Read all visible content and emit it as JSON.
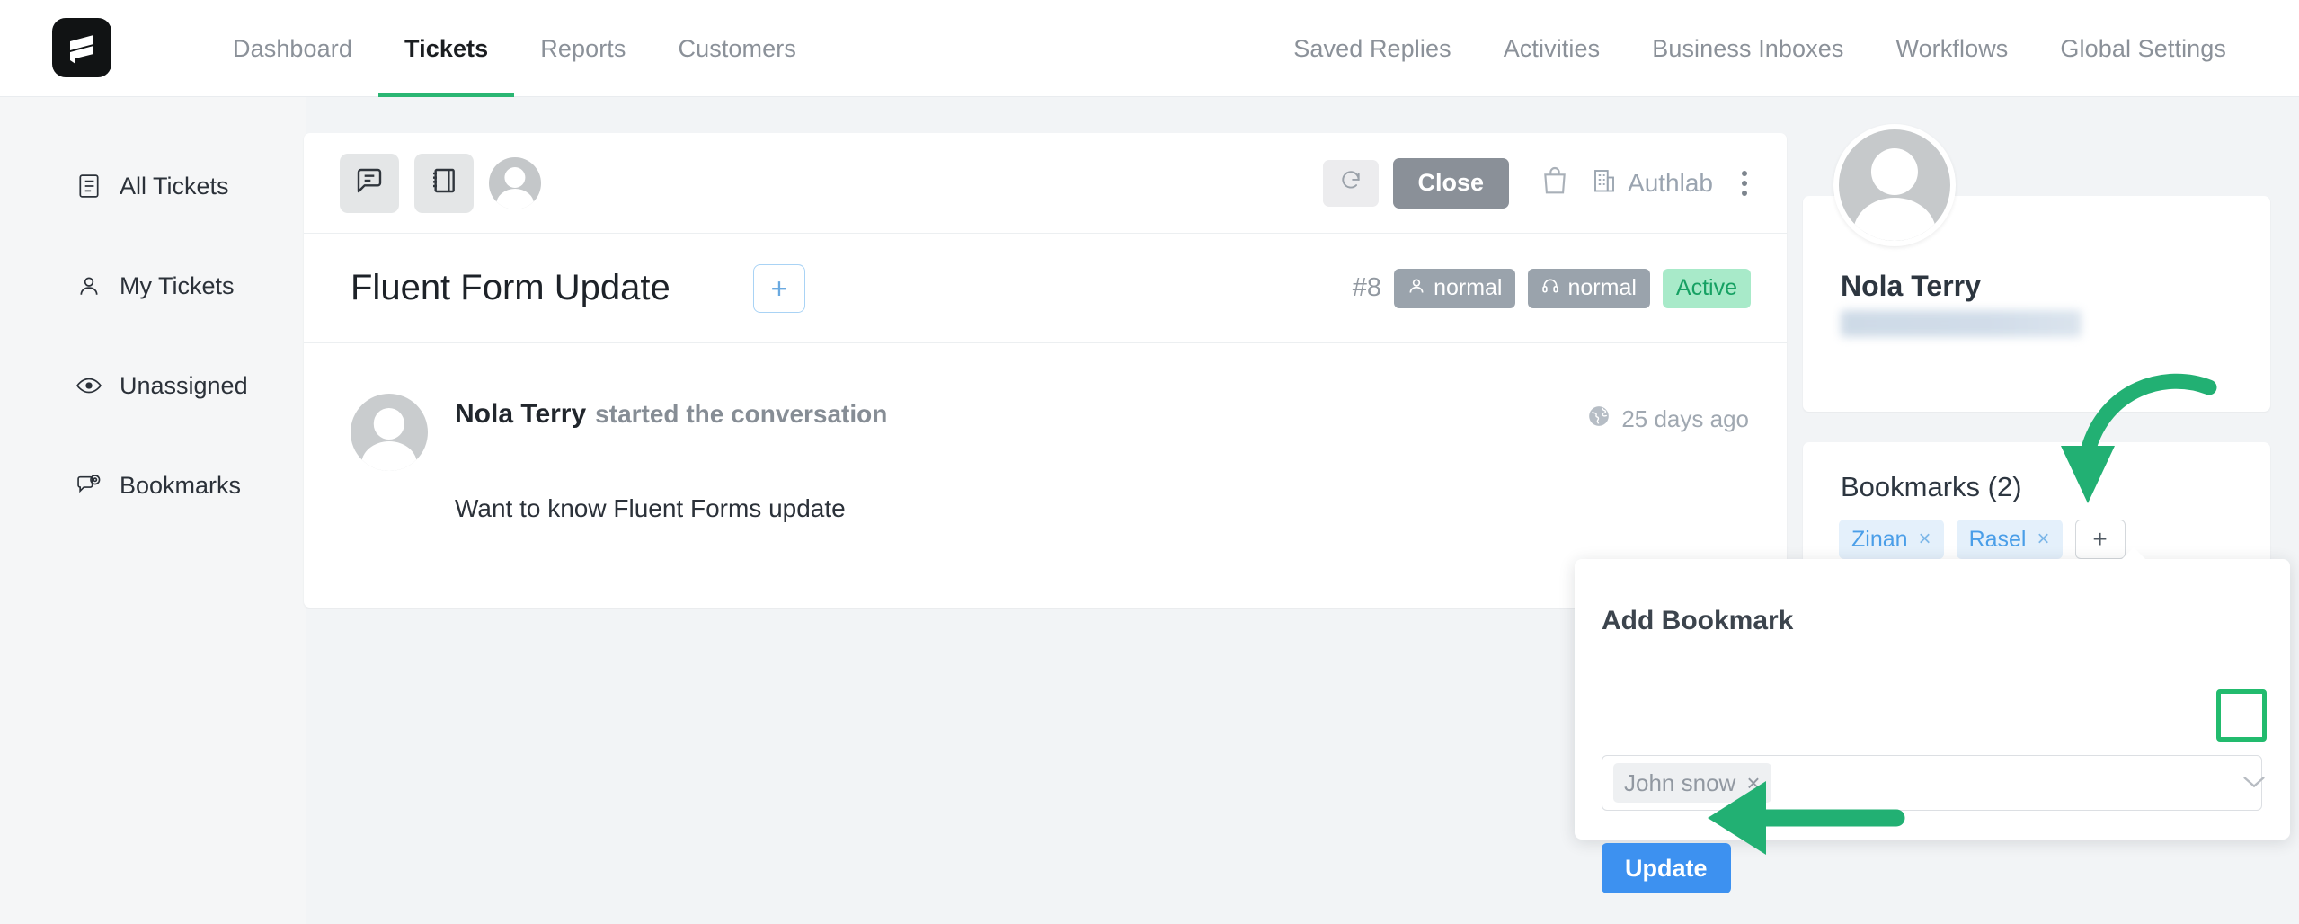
{
  "app": {
    "logo_name": "fluent-support-logo"
  },
  "topnav": {
    "left_items": [
      {
        "label": "Dashboard",
        "active": false
      },
      {
        "label": "Tickets",
        "active": true
      },
      {
        "label": "Reports",
        "active": false
      },
      {
        "label": "Customers",
        "active": false
      }
    ],
    "right_items": [
      {
        "label": "Saved Replies"
      },
      {
        "label": "Activities"
      },
      {
        "label": "Business Inboxes"
      },
      {
        "label": "Workflows"
      },
      {
        "label": "Global Settings"
      }
    ]
  },
  "sidebar": {
    "items": [
      {
        "label": "All Tickets",
        "icon": "document-list-icon"
      },
      {
        "label": "My Tickets",
        "icon": "user-icon"
      },
      {
        "label": "Unassigned",
        "icon": "eye-icon"
      },
      {
        "label": "Bookmarks",
        "icon": "chat-at-icon"
      }
    ]
  },
  "ticket": {
    "toolbar": {
      "conversation_icon": "chat-bubble-icon",
      "notes_icon": "notebook-icon",
      "assignee_avatar": "avatar",
      "refresh_icon": "refresh-icon",
      "close_label": "Close",
      "bag_icon": "shopping-bag-icon",
      "business_icon": "building-icon",
      "business_label": "Authlab",
      "more_icon": "kebab-menu-icon"
    },
    "title": "Fluent Form Update",
    "add_tag_label": "+",
    "number": "#8",
    "badges": [
      {
        "label": "normal",
        "icon": "user-icon",
        "style": "grey"
      },
      {
        "label": "normal",
        "icon": "headset-icon",
        "style": "grey"
      },
      {
        "label": "Active",
        "icon": "",
        "style": "green"
      }
    ],
    "conversation": {
      "author": "Nola Terry",
      "action": "started the conversation",
      "timestamp": "25 days ago",
      "timestamp_icon": "globe-icon",
      "message": "Want to know Fluent Forms update"
    }
  },
  "right_panel": {
    "profile": {
      "avatar": "avatar",
      "name": "Nola Terry",
      "email_redacted": true,
      "more_icon": "ellipsis-icon"
    },
    "bookmarks": {
      "title": "Bookmarks (2)",
      "tags": [
        {
          "label": "Zinan",
          "remove": "×"
        },
        {
          "label": "Rasel",
          "remove": "×"
        }
      ],
      "add_label": "+"
    }
  },
  "popover": {
    "title": "Add Bookmark",
    "select": {
      "token_label": "John snow",
      "token_remove": "×",
      "caret_icon": "chevron-down-icon",
      "placeholder": ""
    },
    "update_label": "Update"
  },
  "annotations": {
    "arrow_color": "#22bb6e",
    "highlight_color": "#22bb6e",
    "curved_arrow": "points-to-add-bookmark-plus-button",
    "straight_arrow": "points-to-update-button",
    "highlight_box": "around-select-dropdown-caret"
  },
  "colors": {
    "accent_green": "#2bb673",
    "primary_blue": "#3d91f0",
    "page_bg": "#f2f4f6",
    "sidebar_bg": "#f5f6f7",
    "badge_grey": "#9aa3ac",
    "badge_green_bg": "#a8eac9",
    "badge_green_text": "#16a163"
  }
}
